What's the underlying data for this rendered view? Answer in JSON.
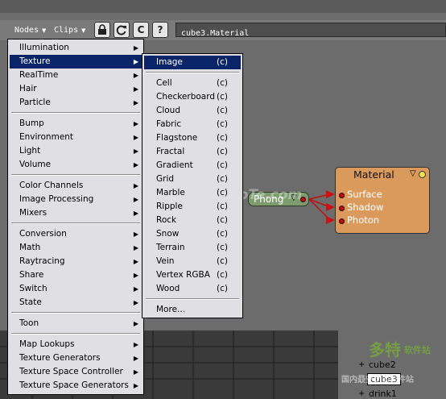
{
  "toolbar": {
    "menus": [
      "Nodes",
      "Clips"
    ],
    "lock_label": "",
    "refresh_label": "",
    "c_label": "C",
    "help_label": "?",
    "path": "cube3.Material"
  },
  "nodes_menu": {
    "groups": [
      [
        "Illumination",
        "Texture",
        "RealTime",
        "Hair",
        "Particle"
      ],
      [
        "Bump",
        "Environment",
        "Light",
        "Volume"
      ],
      [
        "Color Channels",
        "Image Processing",
        "Mixers"
      ],
      [
        "Conversion",
        "Math",
        "Raytracing",
        "Share",
        "Switch",
        "State"
      ],
      [
        "Toon"
      ],
      [
        "Map Lookups",
        "Texture Generators",
        "Texture Space Controller",
        "Texture Space Generators"
      ]
    ],
    "highlighted": "Texture"
  },
  "texture_submenu": {
    "items": [
      {
        "label": "Image",
        "tag": "(c)"
      },
      {
        "label": "Cell",
        "tag": "(c)"
      },
      {
        "label": "Checkerboard",
        "tag": "(c)"
      },
      {
        "label": "Cloud",
        "tag": "(c)"
      },
      {
        "label": "Fabric",
        "tag": "(c)"
      },
      {
        "label": "Flagstone",
        "tag": "(c)"
      },
      {
        "label": "Fractal",
        "tag": "(c)"
      },
      {
        "label": "Gradient",
        "tag": "(c)"
      },
      {
        "label": "Grid",
        "tag": "(c)"
      },
      {
        "label": "Marble",
        "tag": "(c)"
      },
      {
        "label": "Ripple",
        "tag": "(c)"
      },
      {
        "label": "Rock",
        "tag": "(c)"
      },
      {
        "label": "Snow",
        "tag": "(c)"
      },
      {
        "label": "Terrain",
        "tag": "(c)"
      },
      {
        "label": "Vein",
        "tag": "(c)"
      },
      {
        "label": "Vertex RGBA",
        "tag": "(c)"
      },
      {
        "label": "Wood",
        "tag": "(c)"
      }
    ],
    "more": "More...",
    "highlighted": "Image"
  },
  "graph": {
    "phong": "Phong",
    "material": {
      "title": "Material",
      "ports": [
        "Surface",
        "Shadow",
        "Photon"
      ]
    }
  },
  "explorer": {
    "items": [
      "cube2",
      "cube3",
      "drink1"
    ]
  },
  "watermarks": {
    "left": "www.DuoTe.com",
    "right": "多特",
    "right_sub": "软件站",
    "right_line2": "国内最安全的软件站"
  },
  "colors": {
    "highlight": "#0a246a",
    "menu_bg": "#e0dfe3",
    "material_node": "#d99a5c",
    "phong_node": "#7d9c6e",
    "port_dot": "#c01010"
  }
}
